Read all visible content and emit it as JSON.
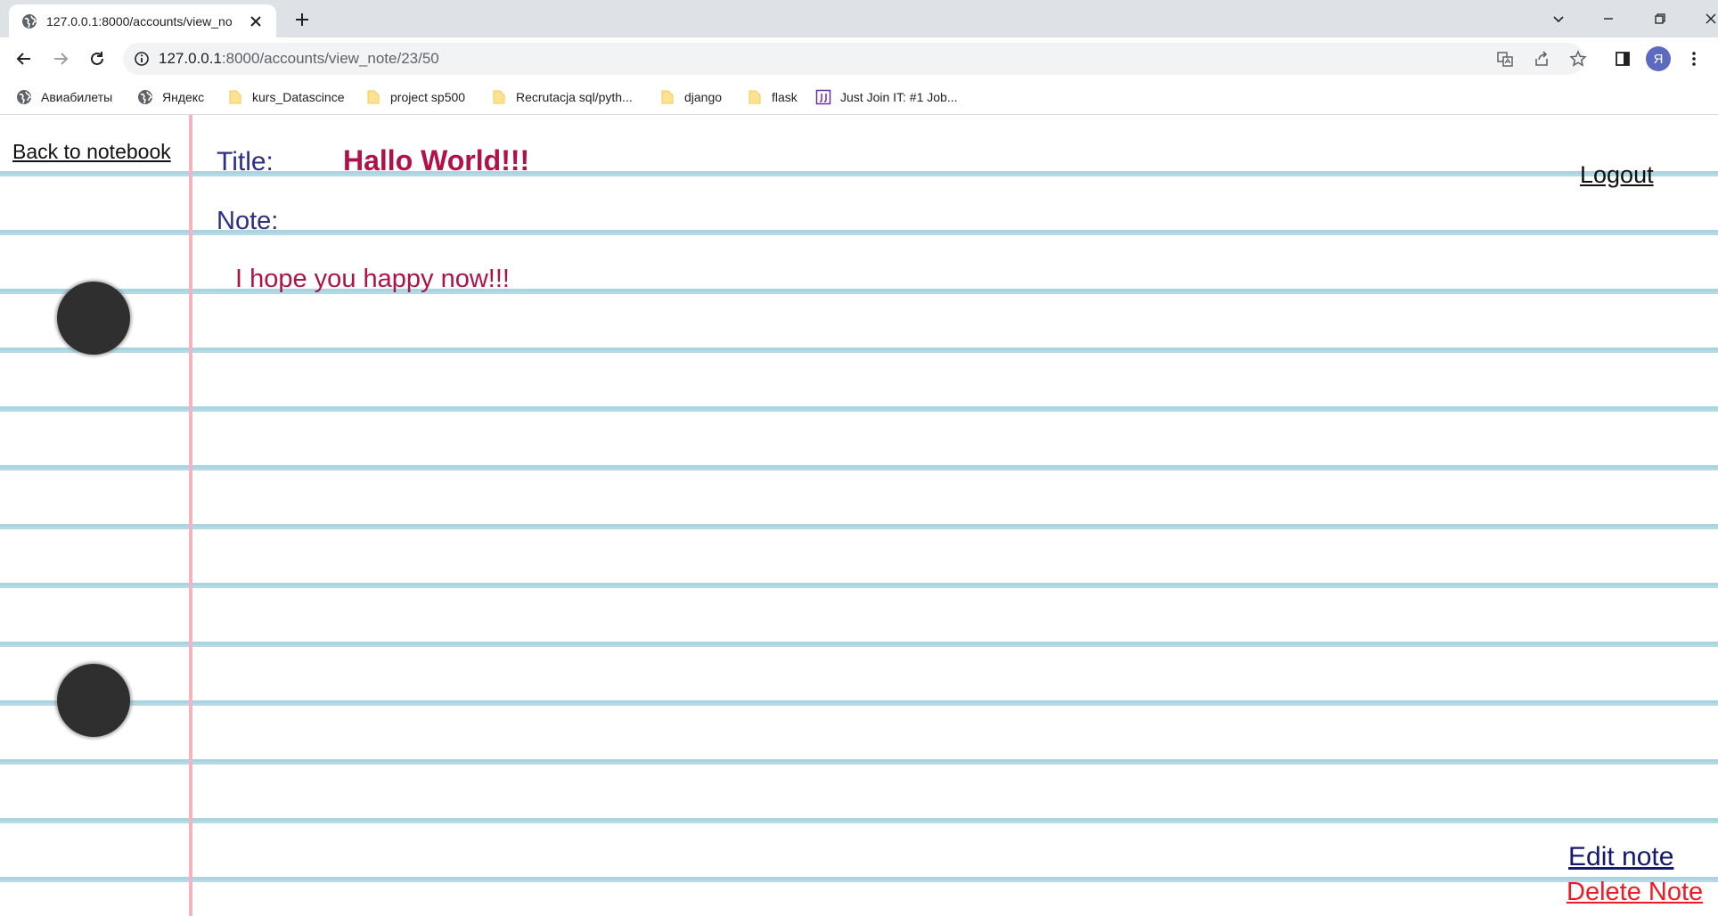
{
  "browser": {
    "tab_title": "127.0.0.1:8000/accounts/view_no",
    "url_host": "127.0.0.1",
    "url_path": ":8000/accounts/view_note/23/50",
    "profile_initial": "Я",
    "bookmarks": [
      {
        "label": "Авиабилеты",
        "icon": "globe-icon"
      },
      {
        "label": "Яндекс",
        "icon": "globe-icon"
      },
      {
        "label": "kurs_Datascince",
        "icon": "folder-icon"
      },
      {
        "label": "project sp500",
        "icon": "folder-icon"
      },
      {
        "label": "Recrutacja sql/pyth...",
        "icon": "folder-icon"
      },
      {
        "label": "django",
        "icon": "folder-icon"
      },
      {
        "label": "flask",
        "icon": "folder-icon"
      },
      {
        "label": "Just Join IT: #1 Job...",
        "icon": "justjoinit-icon"
      }
    ]
  },
  "page": {
    "back_link": "Back to notebook",
    "logout_link": "Logout",
    "title_label": "Title:",
    "title_value": "Hallo World!!!",
    "note_label": "Note:",
    "note_text": "I hope you happy now!!!",
    "edit_link": "Edit note",
    "delete_link": "Delete Note"
  },
  "colors": {
    "label_blue": "#2b2f86",
    "value_crimson": "#b01248",
    "edit_navy": "#14186e",
    "delete_red": "#ee1b24",
    "rule_line": "#a8d4e0",
    "margin_line": "#f5b3bd"
  }
}
